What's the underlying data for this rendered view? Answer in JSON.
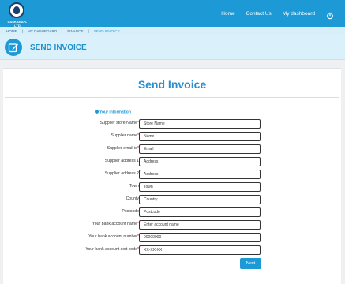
{
  "brand": {
    "logo_text": "LASKANAH-LTD"
  },
  "nav": {
    "home": "Home",
    "contact": "Contact Us",
    "dashboard": "My dashboard",
    "logout_icon": "power-icon"
  },
  "breadcrumb": {
    "home": "HOME",
    "dashboard": "MY DASHBOARD",
    "finance": "FINANCE",
    "current": "SEND INVOICE",
    "separator": "|"
  },
  "header": {
    "title": "SEND INVOICE",
    "icon": "edit-icon"
  },
  "form": {
    "title": "Send Invoice",
    "section_label": "Your information",
    "fields": [
      {
        "label": "Supplier store Name",
        "required": "*",
        "placeholder": "Store Name"
      },
      {
        "label": "Supplier name",
        "required": "*",
        "placeholder": "Name"
      },
      {
        "label": "Supplier email id",
        "required": "*",
        "placeholder": "Email"
      },
      {
        "label": "Supplier address 1",
        "required": "",
        "placeholder": "Address"
      },
      {
        "label": "Supplier address 2",
        "required": "",
        "placeholder": "Address"
      },
      {
        "label": "Town",
        "required": "",
        "placeholder": "Town"
      },
      {
        "label": "County",
        "required": "",
        "placeholder": "Country"
      },
      {
        "label": "Postcode",
        "required": "",
        "placeholder": "Postcode"
      },
      {
        "label": "Your bank account name",
        "required": "*",
        "placeholder": "Enter account name"
      },
      {
        "label": "Your bank account number",
        "required": "*",
        "placeholder": "00000000"
      },
      {
        "label": "Your bank account sort code",
        "required": "*",
        "placeholder": "XX-XX-XX"
      }
    ],
    "next_label": "Next"
  },
  "colors": {
    "primary": "#1d9ad6",
    "header_bg": "#daf0fa",
    "required": "#d0021b"
  }
}
